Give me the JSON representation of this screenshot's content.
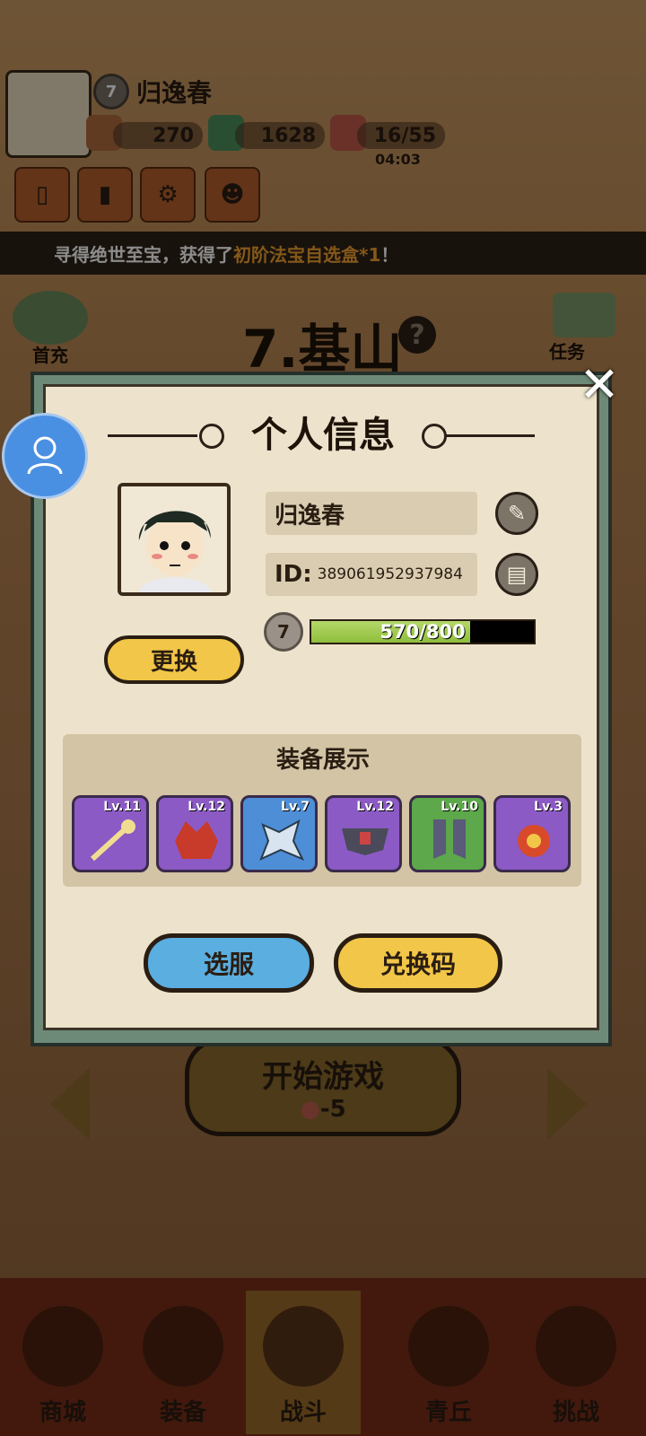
{
  "top": {
    "player_level": "7",
    "player_name": "归逸春",
    "currency1": "270",
    "currency2": "1628",
    "stamina": "16/55",
    "timer": "04:03"
  },
  "banner": {
    "prefix": "寻得绝世至宝，获得了 ",
    "highlight": "初阶法宝自选盒*1",
    "suffix": "！"
  },
  "stage": {
    "title": "7.基山",
    "left_label": "首充",
    "right_label": "任务"
  },
  "start": {
    "label": "开始游戏",
    "cost": "-5"
  },
  "dialog": {
    "title": "个人信息",
    "name": "归逸春",
    "id_label": "ID:",
    "id_value": "389061952937984",
    "level": "7",
    "xp_text": "570/800",
    "xp_fraction": 0.7125,
    "change_label": "更换",
    "equip_title": "装备展示",
    "equipment": [
      {
        "level": "Lv.11",
        "rarity": "purple",
        "icon": "staff-icon"
      },
      {
        "level": "Lv.12",
        "rarity": "purple",
        "icon": "helmet-icon"
      },
      {
        "level": "Lv.7",
        "rarity": "blue",
        "icon": "armor-icon"
      },
      {
        "level": "Lv.12",
        "rarity": "purple",
        "icon": "belt-icon"
      },
      {
        "level": "Lv.10",
        "rarity": "green",
        "icon": "boots-icon"
      },
      {
        "level": "Lv.3",
        "rarity": "purple",
        "icon": "orb-icon"
      }
    ],
    "server_label": "选服",
    "code_label": "兑换码"
  },
  "bottom_nav": [
    {
      "label": "商城"
    },
    {
      "label": "装备"
    },
    {
      "label": "战斗"
    },
    {
      "label": "青丘"
    },
    {
      "label": "挑战"
    }
  ],
  "colors": {
    "dialog_border": "#6d8a78",
    "dialog_bg": "#ede3cc",
    "yellow_button": "#f2c648",
    "blue_button": "#5aaee0",
    "highlight": "#f0a030"
  }
}
